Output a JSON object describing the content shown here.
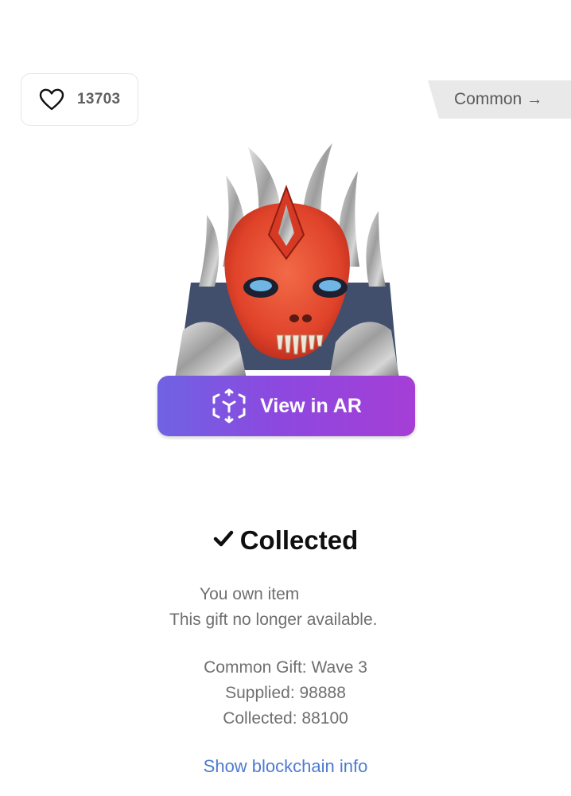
{
  "like": {
    "icon": "heart-icon",
    "count": "13703"
  },
  "rarity": {
    "label": "Common",
    "arrow": "→"
  },
  "gift": {
    "image": "red-silver-spiked-mask-creature",
    "colors": {
      "mask": "#e4462b",
      "metal": "#b9b9b9",
      "teeth": "#efe6d6"
    }
  },
  "ar_button": {
    "icon": "ar-cube-icon",
    "label": "View in AR",
    "gradient": [
      "#6f63e2",
      "#a53ed6"
    ]
  },
  "status": {
    "icon": "checkmark-icon",
    "title": "Collected"
  },
  "ownership": {
    "line1": "You own item",
    "line2": "This gift no longer available."
  },
  "details": {
    "wave": "Common Gift: Wave 3",
    "supplied": "Supplied: 98888",
    "collected": "Collected: 88100"
  },
  "links": {
    "blockchain": "Show blockchain info",
    "color": "#4d7bd0"
  }
}
